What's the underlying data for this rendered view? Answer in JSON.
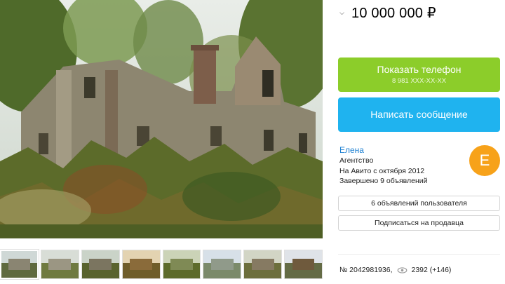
{
  "listing": {
    "price": "10 000 000 ₽",
    "price_dropdown_icon": "chevron-down-icon"
  },
  "photo": {
    "alt": "Разрушенная усадьба",
    "thumbnails": [
      {
        "sky": "#cfd8d6",
        "ground": "#5f6a3f",
        "bld": "#8a8572"
      },
      {
        "sky": "#d8ddd6",
        "ground": "#6f7a40",
        "bld": "#9b9683"
      },
      {
        "sky": "#cad3c8",
        "ground": "#59632e",
        "bld": "#7b7560"
      },
      {
        "sky": "#e3d3b1",
        "ground": "#6f5d2a",
        "bld": "#8a6b3a"
      },
      {
        "sky": "#cbd3b7",
        "ground": "#5d6b2b",
        "bld": "#7f8a55"
      },
      {
        "sky": "#d7e0e8",
        "ground": "#7b8a6a",
        "bld": "#909a8a"
      },
      {
        "sky": "#d2d5c5",
        "ground": "#6c6e3c",
        "bld": "#867a62"
      },
      {
        "sky": "#dfe3e8",
        "ground": "#646b45",
        "bld": "#6f5a3d"
      }
    ]
  },
  "buttons": {
    "show_phone": "Показать телефон",
    "phone_masked": "8 981 XXX-XX-XX",
    "write_message": "Написать сообщение",
    "user_ads": "6 объявлений пользователя",
    "subscribe": "Подписаться на продавца"
  },
  "seller": {
    "name": "Елена",
    "type": "Агентство",
    "since": "На Авито с октября 2012",
    "completed": "Завершено 9 объявлений",
    "avatar_letter": "Е"
  },
  "meta": {
    "ad_number": "№ 2042981936,",
    "views": "2392 (+146)",
    "views_icon": "eye-icon"
  },
  "colors": {
    "phone_button": "#8ccd2a",
    "message_button": "#1fb3ef",
    "avatar": "#f7a21a",
    "seller_link": "#1b7fd1"
  }
}
